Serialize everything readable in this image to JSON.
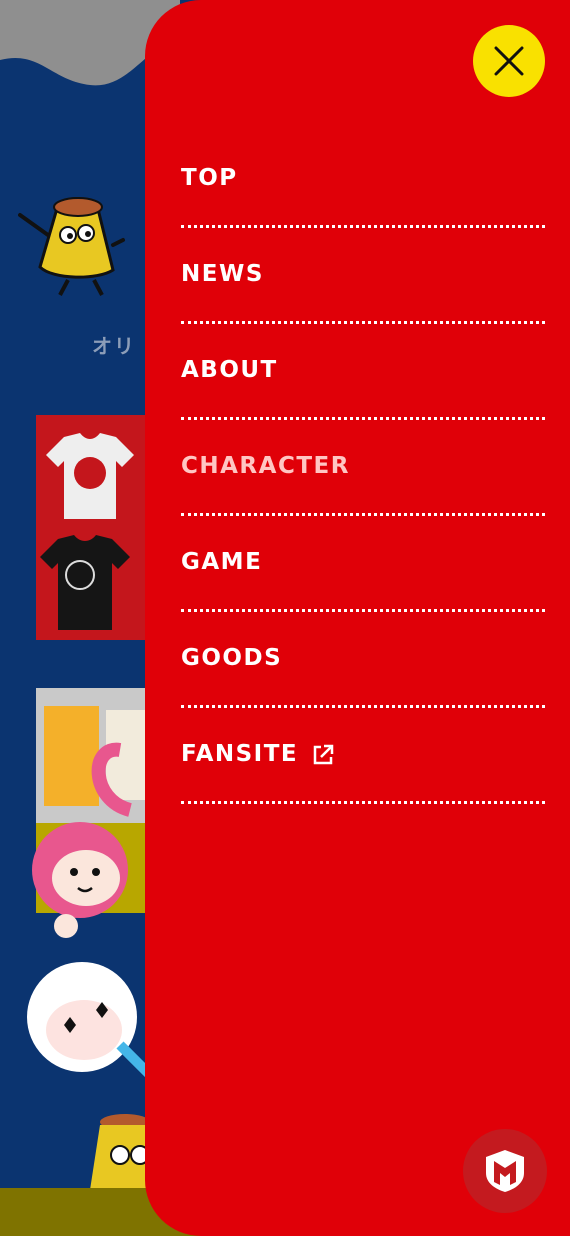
{
  "background": {
    "heading_fragment": "オリ"
  },
  "drawer": {
    "close_label": "×",
    "menu": [
      {
        "label": "TOP",
        "active": false,
        "external": false
      },
      {
        "label": "NEWS",
        "active": false,
        "external": false
      },
      {
        "label": "ABOUT",
        "active": false,
        "external": false
      },
      {
        "label": "CHARACTER",
        "active": true,
        "external": false
      },
      {
        "label": "GAME",
        "active": false,
        "external": false
      },
      {
        "label": "GOODS",
        "active": false,
        "external": false
      },
      {
        "label": "FANSITE",
        "active": false,
        "external": true
      }
    ],
    "external_icon": "external-link-icon",
    "badge_icon": "mcafee-shield-icon"
  },
  "colors": {
    "drawer_bg": "#e00008",
    "close_bg": "#f9e100",
    "page_bg": "#0b3470",
    "active_label": "#ffc6c3"
  }
}
